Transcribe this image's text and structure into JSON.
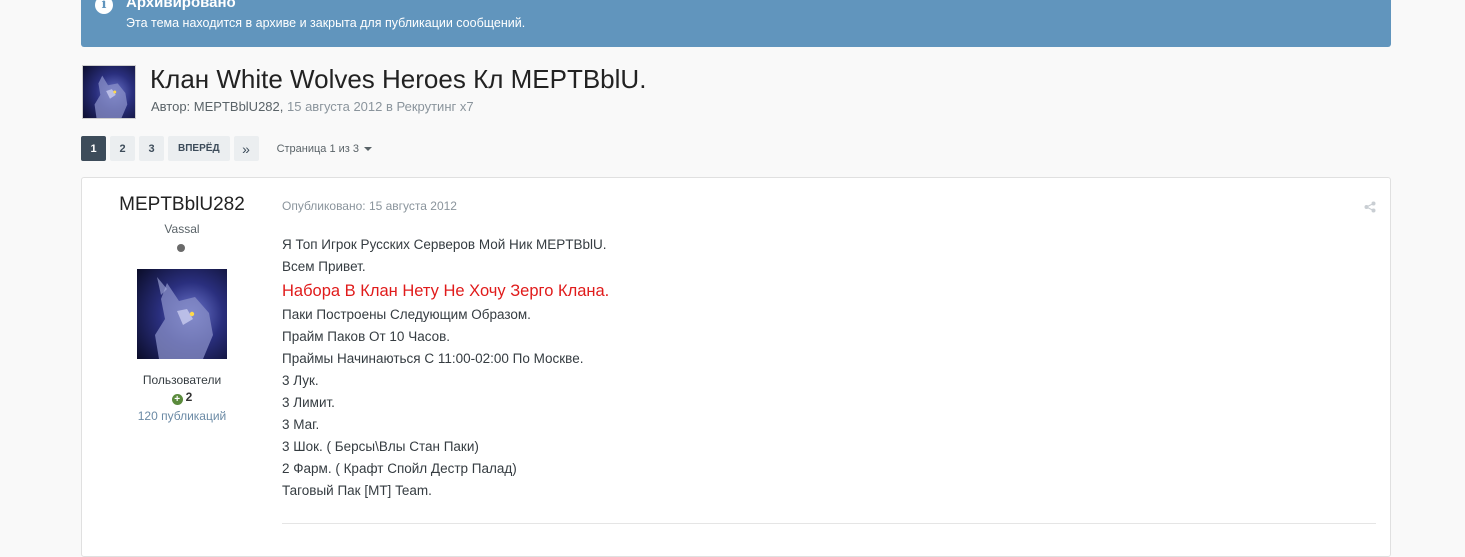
{
  "archive": {
    "title": "Архивировано",
    "description": "Эта тема находится в архиве и закрыта для публикации сообщений."
  },
  "topic": {
    "title": "Клан White Wolves Heroes Кл MEPTBblU.",
    "meta_prefix": "Автор: MEPTBblU282, ",
    "meta_date": "15 августа 2012",
    "meta_forum": " в Рекрутинг x7"
  },
  "pagination": {
    "pages": [
      "1",
      "2",
      "3"
    ],
    "active_page": "1",
    "next_label": "ВПЕРЁД",
    "last_symbol": "»",
    "page_info": "Страница 1 из 3"
  },
  "post": {
    "author_name": "MEPTBblU282",
    "author_rank": "Vassal",
    "author_group": "Пользователи",
    "reputation": "2",
    "post_count": "120 публикаций",
    "published": "Опубликовано: 15 августа 2012",
    "lines": [
      "Я Топ Игрок Русских Серверов Мой Ник MEPTBblU.",
      "Всем Привет.",
      "Набора В Клан Нету Не Хочу Зерго Клана.",
      "Паки Построены Следующим Образом.",
      "Прайм Паков От 10 Часов.",
      "Праймы Начинаються С 11:00-02:00 По Москве.",
      "3 Лук.",
      "3 Лимит.",
      "3 Маг.",
      "3 Шок. ( Берсы\\Влы Стан Паки)",
      "2 Фарм. ( Крафт Спойл Дестр Палад)",
      "Таговый Пак [MT] Team."
    ]
  },
  "colors": {
    "banner": "#6195bd",
    "highlight_text": "#e01b1b",
    "active_page": "#3d4c5a"
  }
}
